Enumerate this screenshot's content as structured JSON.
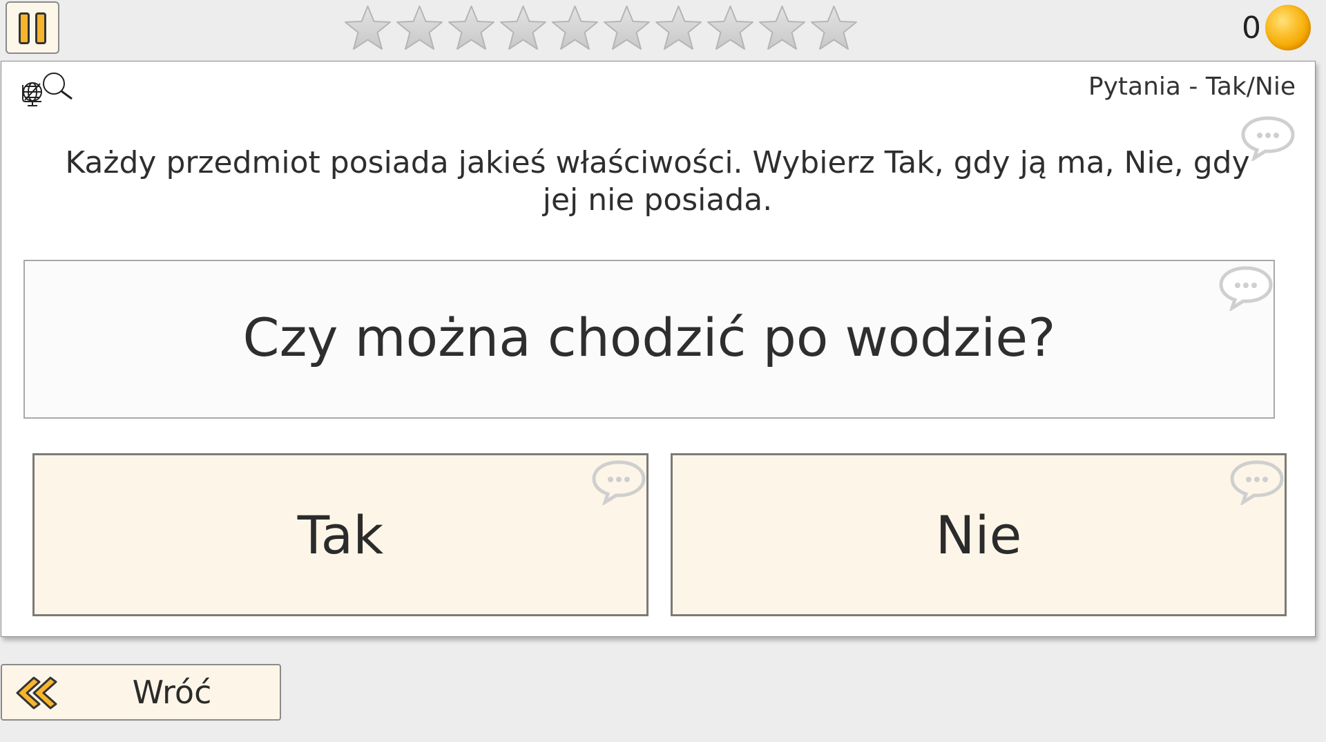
{
  "top_bar": {
    "pause_icon": "pause-icon",
    "stars": {
      "filled": 0,
      "total": 10,
      "icon": "star-icon",
      "empty_color": "#c8c8c8"
    },
    "coins": {
      "count": "0",
      "icon": "coin-icon"
    }
  },
  "panel": {
    "category_icon": "globe-search-icon",
    "category": "Pytania - Tak/Nie",
    "instruction": "Każdy przedmiot posiada jakieś właściwości. Wybierz Tak, gdy ją ma, Nie, gdy jej nie posiada.",
    "question": "Czy można chodzić po wodzie?",
    "hint_icon": "speech-bubble-icon",
    "answers": [
      {
        "label": "Tak"
      },
      {
        "label": "Nie"
      }
    ]
  },
  "footer": {
    "back_icon": "double-chevron-left-icon",
    "back_label": "Wróć"
  },
  "colors": {
    "accent": "#f7b52c",
    "answer_bg": "#fdf6e8",
    "page_bg": "#ededed"
  }
}
